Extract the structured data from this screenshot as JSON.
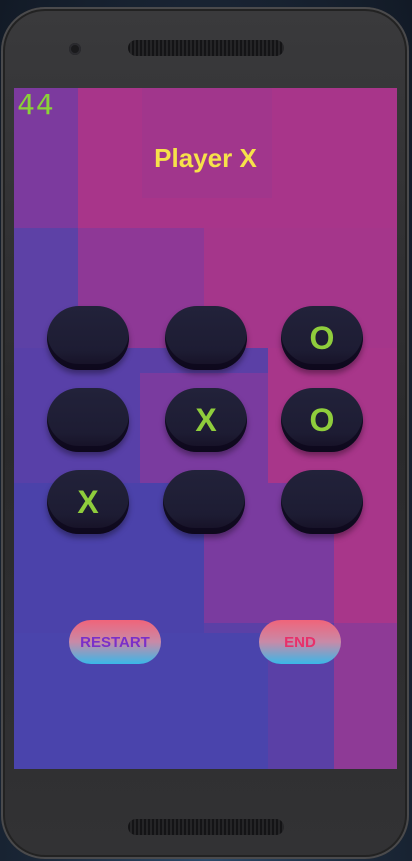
{
  "status": {
    "timer": "44"
  },
  "header": {
    "current_player": "Player X"
  },
  "board": {
    "cells": [
      "",
      "",
      "O",
      "",
      "X",
      "O",
      "X",
      "",
      ""
    ]
  },
  "controls": {
    "restart_label": "RESTART",
    "end_label": "END"
  },
  "colors": {
    "title": "#f6e24a",
    "marks": "#8fcd3c",
    "timer": "#8bd238",
    "background_purple": "#5a3ea8",
    "background_magenta": "#a8358a"
  }
}
